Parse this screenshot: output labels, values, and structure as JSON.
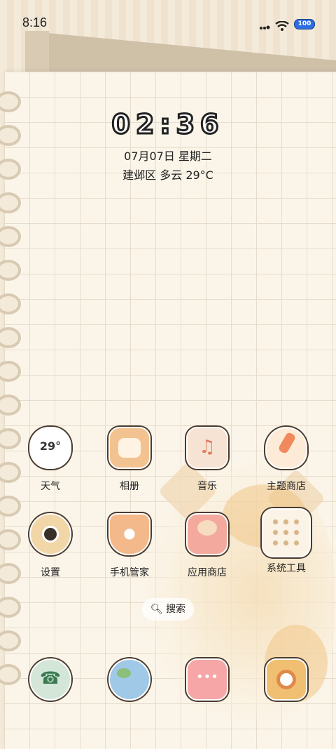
{
  "status_bar": {
    "time": "8:16",
    "battery": "100"
  },
  "lock": {
    "clock": "02:36",
    "date": "07月07日 星期二",
    "weather": "建邺区 多云 29°C"
  },
  "apps_row1": [
    {
      "label": "天气",
      "icon": "weather-cloud-icon",
      "icon_text": "29°"
    },
    {
      "label": "相册",
      "icon": "album-icon"
    },
    {
      "label": "音乐",
      "icon": "music-icon"
    },
    {
      "label": "主题商店",
      "icon": "theme-brush-icon"
    }
  ],
  "apps_row2": [
    {
      "label": "设置",
      "icon": "settings-gear-icon"
    },
    {
      "label": "手机管家",
      "icon": "shield-icon"
    },
    {
      "label": "应用商店",
      "icon": "app-store-icon"
    },
    {
      "label": "系统工具",
      "icon": "system-tools-folder-icon"
    }
  ],
  "search": {
    "label": "搜索"
  },
  "dock": [
    {
      "icon": "phone-icon"
    },
    {
      "icon": "browser-globe-icon"
    },
    {
      "icon": "messages-icon"
    },
    {
      "icon": "camera-icon"
    }
  ],
  "colors": {
    "paper": "#fbf5e9",
    "accent": "#f0b070"
  }
}
